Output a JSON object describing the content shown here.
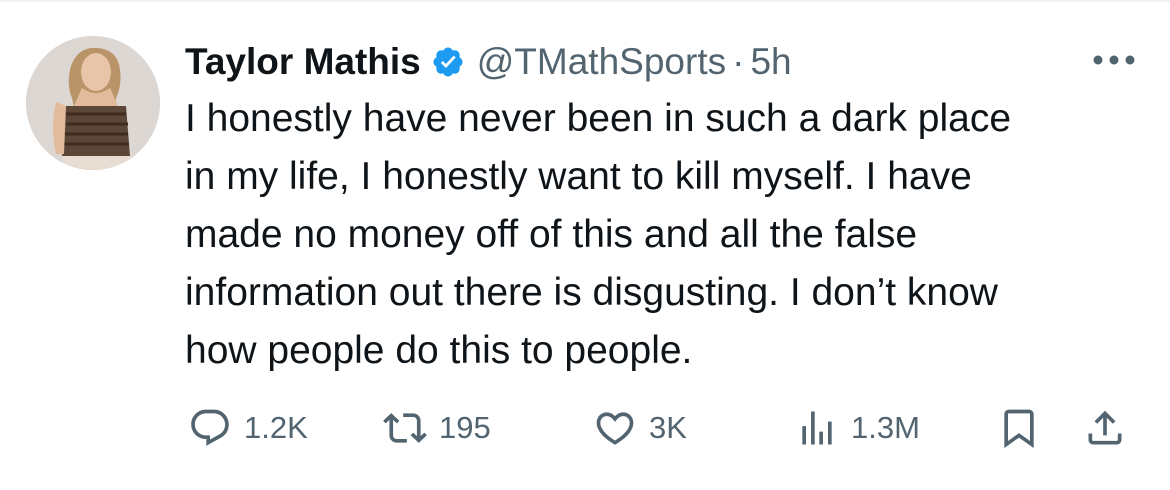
{
  "tweet": {
    "author": {
      "display_name": "Taylor Mathis",
      "handle": "@TMathSports",
      "verified": true
    },
    "separator": "·",
    "time": "5h",
    "text_lines": [
      "I honestly have never been in such a dark place",
      "in my life, I honestly want to kill myself. I have",
      "made no money off of this and all the false",
      "information out there is disgusting. I don’t know",
      "how people do this to people."
    ],
    "stats": {
      "replies": "1.2K",
      "reposts": "195",
      "likes": "3K",
      "views": "1.3M"
    }
  },
  "colors": {
    "text": "#0f1419",
    "secondary": "#536471",
    "verified_blue": "#1d9bf0",
    "divider": "#eff3f4"
  },
  "icons": {
    "verified": "verified-badge-icon",
    "more": "more-horizontal-icon",
    "reply": "reply-bubble-icon",
    "repost": "repost-arrows-icon",
    "like": "heart-icon",
    "views": "bar-chart-icon",
    "bookmark": "bookmark-icon",
    "share": "share-upload-icon"
  }
}
